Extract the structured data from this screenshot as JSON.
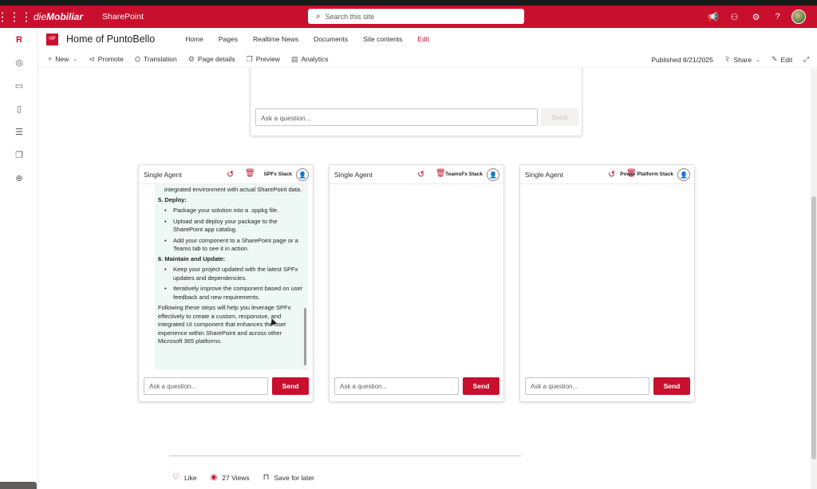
{
  "suitebar": {
    "brand_prefix": "die",
    "brand_name": "Mobiliar",
    "app_name": "SharePoint",
    "search_placeholder": "Search this site",
    "help_label": "?"
  },
  "leftrail": {
    "items": [
      "R"
    ]
  },
  "site": {
    "badge": "HP",
    "title": "Home of PuntoBello",
    "nav": [
      "Home",
      "Pages",
      "Realtime News",
      "Documents",
      "Site contents",
      "Edit"
    ]
  },
  "commandbar": {
    "new_label": "New",
    "promote_label": "Promote",
    "translation_label": "Translation",
    "page_details_label": "Page details",
    "preview_label": "Preview",
    "analytics_label": "Analytics",
    "published_text": "Published 8/21/2025",
    "share_label": "Share",
    "edit_label": "Edit"
  },
  "top_agent": {
    "input_placeholder": "Ask a question...",
    "send_label": "Send"
  },
  "cards": [
    {
      "title": "Single Agent",
      "stack": "SPFx Stack",
      "input_placeholder": "Ask a question...",
      "send_label": "Send",
      "chat": {
        "intro": "integrated environment with actual SharePoint data.",
        "sections": [
          {
            "heading": "5. Deploy:",
            "bullets": [
              "Package your solution into a .sppkg file.",
              "Upload and deploy your package to the SharePoint app catalog.",
              "Add your component to a SharePoint page or a Teams tab to see it in action."
            ]
          },
          {
            "heading": "6. Maintain and Update:",
            "bullets": [
              "Keep your project updated with the latest SPFx updates and dependencies.",
              "Iteratively improve the component based on user feedback and new requirements."
            ]
          }
        ],
        "conclusion": "Following these steps will help you leverage SPFx effectively to create a custom, responsive, and integrated UI component that enhances the user experience within SharePoint and across other Microsoft 365 platforms."
      }
    },
    {
      "title": "Single Agent",
      "stack": "TeamsFx Stack",
      "input_placeholder": "Ask a question...",
      "send_label": "Send"
    },
    {
      "title": "Single Agent",
      "stack": "Power Platform Stack",
      "input_placeholder": "Ask a question...",
      "send_label": "Send"
    }
  ],
  "footer": {
    "like_label": "Like",
    "views_label": "27 Views",
    "save_label": "Save for later"
  },
  "colors": {
    "brand_red": "#c8102e",
    "chat_bg": "#eef8f5"
  }
}
